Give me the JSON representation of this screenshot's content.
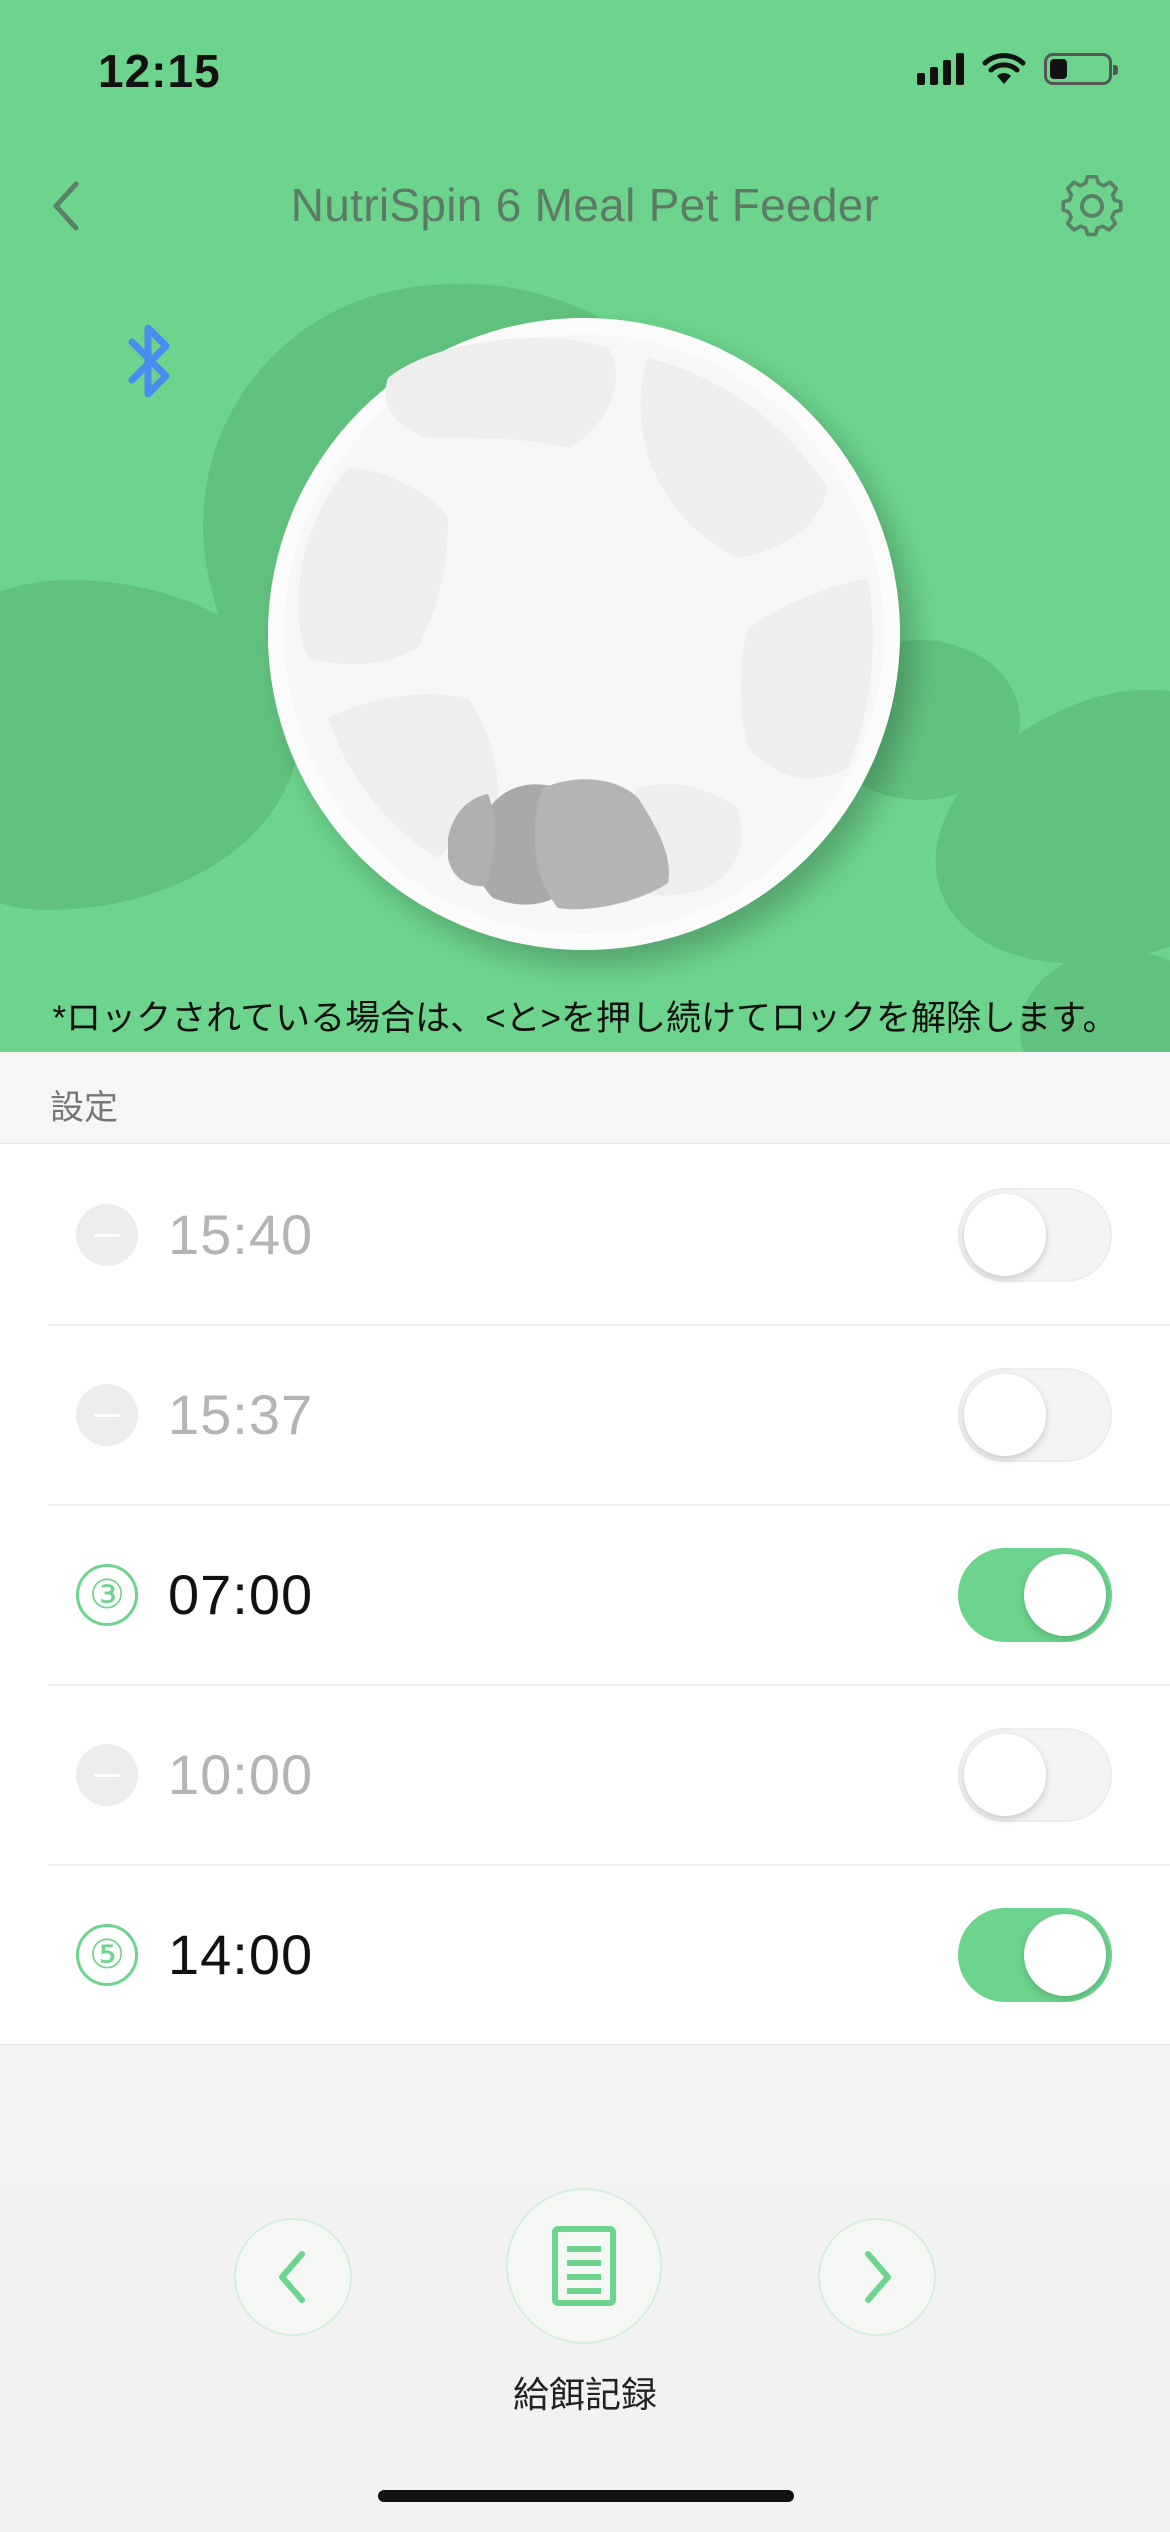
{
  "status_bar": {
    "time": "12:15",
    "icons": [
      "cellular-signal-icon",
      "wifi-icon",
      "battery-icon"
    ],
    "battery_level": 0.3
  },
  "nav": {
    "back_icon": "chevron-left-icon",
    "title": "NutriSpin 6 Meal Pet Feeder",
    "settings_icon": "gear-icon"
  },
  "device": {
    "bluetooth_icon": "bluetooth-icon",
    "lock_note": "*ロックされている場合は、<と>を押し続けてロックを解除します。"
  },
  "settings": {
    "section_label": "設定",
    "schedules": [
      {
        "slot": "",
        "time": "15:40",
        "enabled": false
      },
      {
        "slot": "",
        "time": "15:37",
        "enabled": false
      },
      {
        "slot": "③",
        "time": "07:00",
        "enabled": true
      },
      {
        "slot": "",
        "time": "10:00",
        "enabled": false
      },
      {
        "slot": "⑤",
        "time": "14:00",
        "enabled": true
      }
    ]
  },
  "bottom": {
    "prev_icon": "chevron-left-icon",
    "log_icon": "document-list-icon",
    "next_icon": "chevron-right-icon",
    "log_label": "給餌記録"
  },
  "colors": {
    "accent": "#6dd48d",
    "hero_background": "#6dd48d",
    "bluetooth": "#4a8df0",
    "disabled_text": "#b4b4b4"
  }
}
